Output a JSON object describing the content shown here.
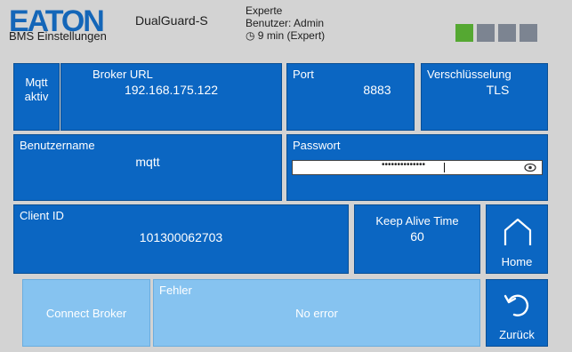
{
  "header": {
    "logo_text": "EATON",
    "subtitle": "BMS Einstellungen",
    "device": "DualGuard-S",
    "mode_line1": "Experte",
    "user": "Benutzer: Admin",
    "session": "◷ 9 min (Expert)",
    "indicators": [
      "#55a832",
      "#7c8491",
      "#7c8491",
      "#7c8491"
    ]
  },
  "mqtt": {
    "status_label": "Mqtt",
    "status_value": "aktiv",
    "broker_label": "Broker URL",
    "broker_value": "192.168.175.122",
    "port_label": "Port",
    "port_value": "8883",
    "encryption_label": "Verschlüsselung",
    "encryption_value": "TLS",
    "username_label": "Benutzername",
    "username_value": "mqtt",
    "password_label": "Passwort",
    "password_value": "••••••••••••••",
    "client_id_label": "Client ID",
    "client_id_value": "101300062703",
    "keepalive_label": "Keep Alive Time",
    "keepalive_value": "60",
    "connect_button": "Connect Broker",
    "error_label": "Fehler",
    "error_value": "No error"
  },
  "nav": {
    "home_label": "Home",
    "back_label": "Zurück"
  },
  "colors": {
    "tile": "#0b66c2",
    "tile_light": "#86c3f0",
    "background": "#d3d3d3"
  }
}
